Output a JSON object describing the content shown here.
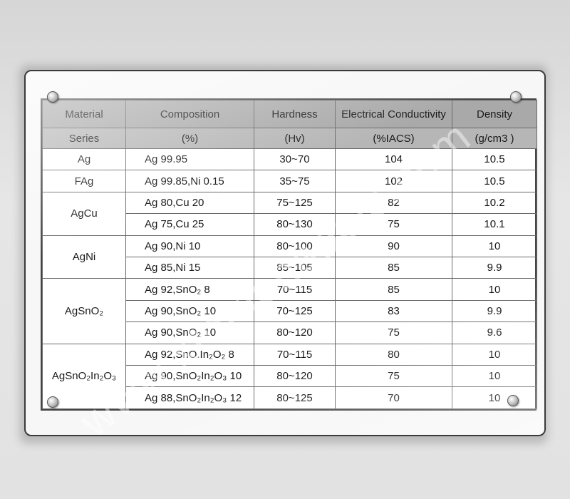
{
  "table": {
    "header_row1": [
      "Material",
      "Composition",
      "Hardness",
      "Electrical Conductivity",
      "Density"
    ],
    "header_row2": [
      "Series",
      "(%)",
      "(Hv)",
      "(%IACS)",
      "(g/cm3 )"
    ],
    "rows": [
      {
        "series": "Ag",
        "composition": "Ag 99.95",
        "hardness": "30~70",
        "conductivity": "104",
        "density": "10.5"
      },
      {
        "series": "FAg",
        "composition": "Ag 99.85,Ni 0.15",
        "hardness": "35~75",
        "conductivity": "102",
        "density": "10.5"
      },
      {
        "series": "AgCu",
        "composition": "Ag 80,Cu 20",
        "hardness": "75~125",
        "conductivity": "82",
        "density": "10.2"
      },
      {
        "series": "",
        "composition": "Ag 75,Cu 25",
        "hardness": "80~130",
        "conductivity": "75",
        "density": "10.1"
      },
      {
        "series": "AgNi",
        "composition": "Ag 90,Ni 10",
        "hardness": "80~100",
        "conductivity": "90",
        "density": "10"
      },
      {
        "series": "",
        "composition": "Ag 85,Ni 15",
        "hardness": "85~105",
        "conductivity": "85",
        "density": "9.9"
      },
      {
        "series": "AgSnO₂",
        "composition": "Ag 92,SnO₂ 8",
        "hardness": "70~115",
        "conductivity": "85",
        "density": "10"
      },
      {
        "series": "",
        "composition": "Ag 90,SnO₂ 10",
        "hardness": "70~125",
        "conductivity": "83",
        "density": "9.9"
      },
      {
        "series": "",
        "composition": "Ag 90,SnO₂ 10",
        "hardness": "80~120",
        "conductivity": "75",
        "density": "9.6"
      },
      {
        "series": "AgSnO₂In₂O₃",
        "composition": "Ag 92,SnO.In₂O₂ 8",
        "hardness": "70~115",
        "conductivity": "80",
        "density": "10"
      },
      {
        "series": "",
        "composition": "Ag 90,SnO₂In₂O₃ 10",
        "hardness": "80~120",
        "conductivity": "75",
        "density": "10"
      },
      {
        "series": "",
        "composition": "Ag 88,SnO₂In₂O₃ 12",
        "hardness": "80~125",
        "conductivity": "70",
        "density": "10"
      }
    ]
  },
  "watermark": "www.xtomenapolo.com"
}
